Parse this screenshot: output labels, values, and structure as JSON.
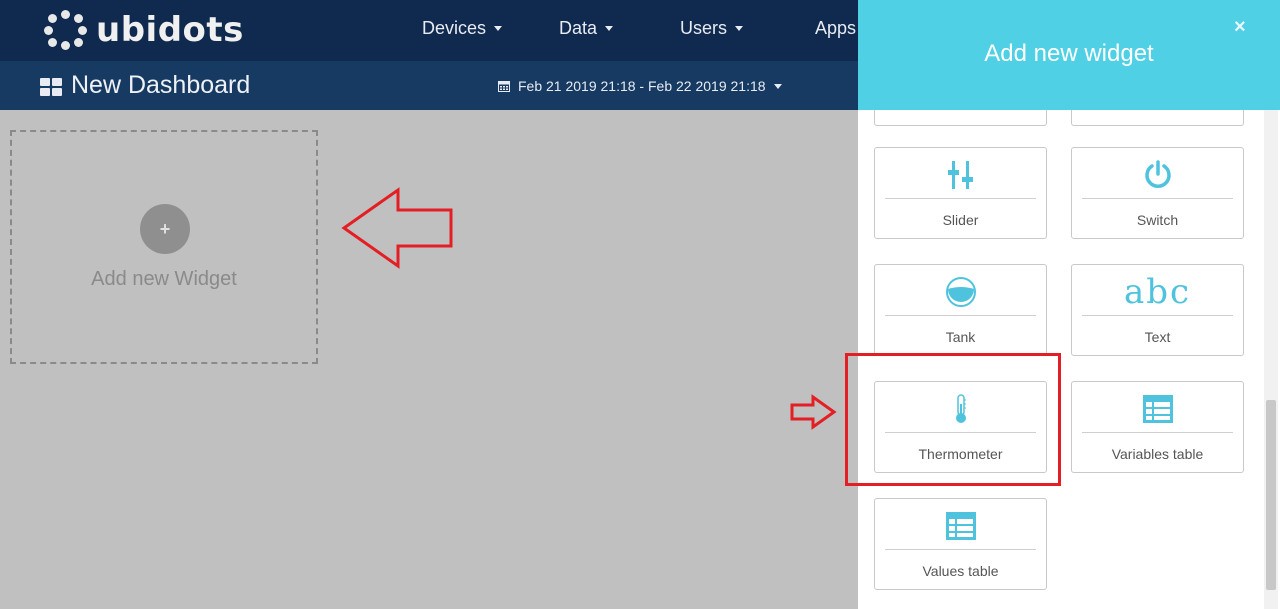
{
  "brand": {
    "name": "ubidots"
  },
  "nav": {
    "items": [
      {
        "label": "Devices"
      },
      {
        "label": "Data"
      },
      {
        "label": "Users"
      },
      {
        "label": "Apps"
      }
    ]
  },
  "dashboard": {
    "title": "New Dashboard",
    "date_range": "Feb 21 2019 21:18 - Feb 22 2019 21:18"
  },
  "main": {
    "add_widget_symbol": "+",
    "add_widget_label": "Add new Widget"
  },
  "panel": {
    "title": "Add new widget",
    "close_symbol": "×",
    "widgets": [
      {
        "label": "Slider",
        "icon": "slider-icon"
      },
      {
        "label": "Switch",
        "icon": "power-icon"
      },
      {
        "label": "Tank",
        "icon": "tank-icon"
      },
      {
        "label": "Text",
        "icon": "abc-text-icon",
        "icon_text": "abc"
      },
      {
        "label": "Thermometer",
        "icon": "thermometer-icon"
      },
      {
        "label": "Variables table",
        "icon": "table-icon"
      },
      {
        "label": "Values table",
        "icon": "table-icon"
      }
    ]
  },
  "colors": {
    "navbar": "#0f2a4e",
    "dashbar": "#173a63",
    "panel_header": "#4fd0e4",
    "icon_accent": "#4fc3dd",
    "annotation": "#e31e24"
  }
}
